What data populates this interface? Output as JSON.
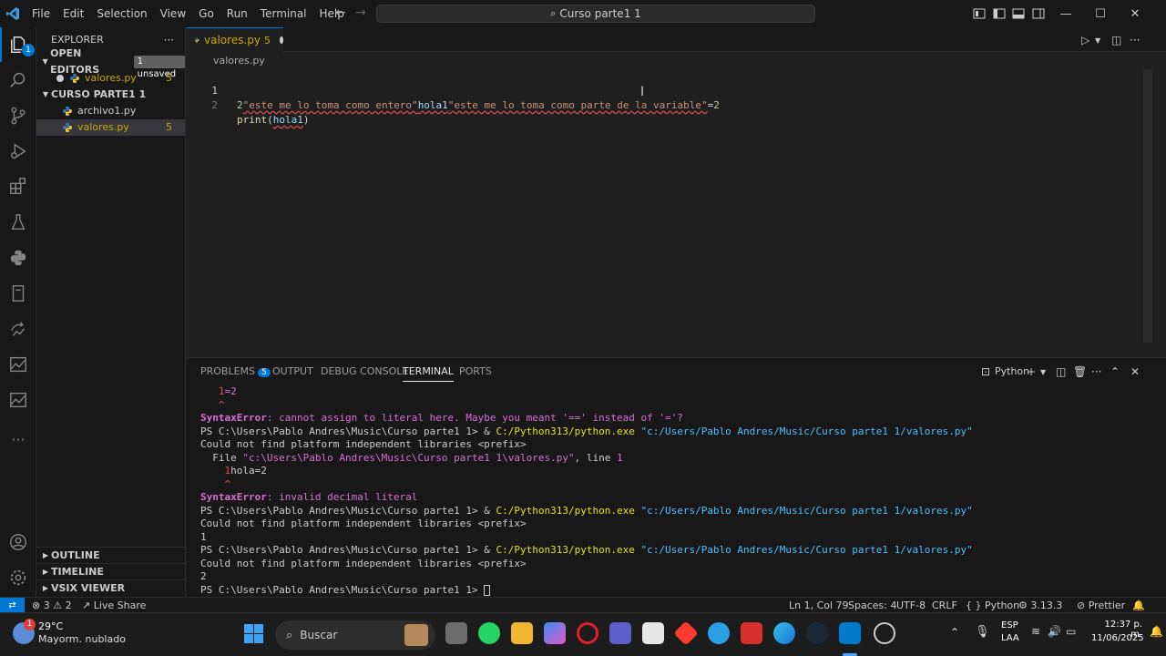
{
  "titlebar": {
    "menu": [
      "File",
      "Edit",
      "Selection",
      "View",
      "Go",
      "Run",
      "Terminal",
      "Help"
    ],
    "command_center": "Curso parte1 1"
  },
  "activitybar": {
    "explorer_badge": "1"
  },
  "sidebar": {
    "title": "EXPLORER",
    "open_editors": {
      "label": "OPEN EDITORS",
      "badge": "1 unsaved",
      "files": [
        {
          "name": "valores.py",
          "problems": "5"
        }
      ]
    },
    "folder": {
      "label": "CURSO PARTE1 1",
      "files": [
        {
          "name": "archivo1.py",
          "problems": ""
        },
        {
          "name": "valores.py",
          "problems": "5"
        }
      ]
    },
    "outline": "OUTLINE",
    "timeline": "TIMELINE",
    "vsix": "VSIX VIEWER"
  },
  "editor": {
    "tab": {
      "name": "valores.py",
      "problems": "5"
    },
    "breadcrumb": "valores.py",
    "lines": [
      {
        "num": "1",
        "p1": "2",
        "p2": "\"este me lo toma como entero\"",
        "p3": "hola1",
        "p4": "\"este me lo toma como parte de la variable\"",
        "p5": "=",
        "p6": "2"
      },
      {
        "num": "2",
        "fn": "print",
        "open": "(",
        "arg": "hola1",
        "close": ")"
      }
    ]
  },
  "panel": {
    "tabs": {
      "problems": "PROBLEMS",
      "problems_count": "5",
      "output": "OUTPUT",
      "debug": "DEBUG CONSOLE",
      "terminal": "TERMINAL",
      "ports": "PORTS"
    },
    "shell": "Python",
    "terminal": {
      "l1a": "1",
      "l1b": "=2",
      "l2": "^",
      "l3a": "SyntaxError",
      "l3b": ": cannot assign to literal here. Maybe you meant '==' instead of '='?",
      "prompt": "PS C:\\Users\\Pablo Andres\\Music\\Curso parte1 1> ",
      "cmd_amp": "& ",
      "cmd_exe": "C:/Python313/python.exe",
      "cmd_arg": " \"c:/Users/Pablo Andres/Music/Curso parte1 1/valores.py\"",
      "warn": "Could not find platform independent libraries <prefix>",
      "file_a": "  File ",
      "file_b": "\"c:\\Users\\Pablo Andres\\Music\\Curso parte1 1\\valores.py\"",
      "file_c": ", line ",
      "file_d": "1",
      "l7a": "1",
      "l7b": "hola=2",
      "l8": "^",
      "l9a": "SyntaxError",
      "l9b": ": invalid decimal literal",
      "out1": "1",
      "out2": "2"
    }
  },
  "statusbar": {
    "errors": "3",
    "warnings": "2",
    "live_share": "Live Share",
    "position": "Ln 1, Col 79",
    "spaces": "Spaces: 4",
    "encoding": "UTF-8",
    "eol": "CRLF",
    "language": "Python",
    "version": "3.13.3",
    "prettier": "Prettier"
  },
  "taskbar": {
    "weather_temp": "29°C",
    "weather_desc": "Mayorm. nublado",
    "weather_badge": "1",
    "search": "Buscar",
    "lang": "ESP",
    "lang2": "LAA",
    "time": "12:37 p. m.",
    "date": "11/06/2025"
  }
}
